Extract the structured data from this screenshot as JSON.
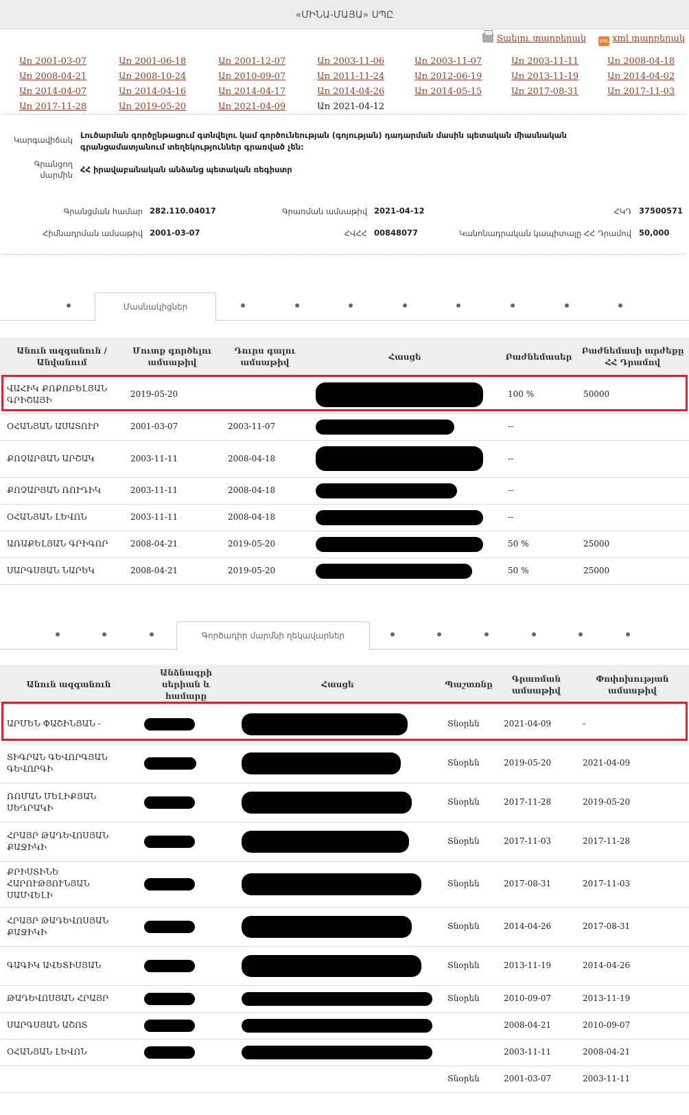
{
  "page": {
    "title": "«ՄԻՆԱ-ՄԱՅԱ» ՍՊԸ",
    "print_label": "Տպելու տարբերակ",
    "xml_label": "xml տարբերակ",
    "icons": {
      "print": "printer-icon",
      "xml": "xml-file-icon"
    },
    "accent_color": "#b03a1a",
    "highlight_color": "#e0202a"
  },
  "dates": [
    {
      "label": "Առ 2001-03-07",
      "current": false
    },
    {
      "label": "Առ 2001-06-18",
      "current": false
    },
    {
      "label": "Առ 2001-12-07",
      "current": false
    },
    {
      "label": "Առ 2003-11-06",
      "current": false
    },
    {
      "label": "Առ 2003-11-07",
      "current": false
    },
    {
      "label": "Առ 2003-11-11",
      "current": false
    },
    {
      "label": "Առ 2008-04-18",
      "current": false
    },
    {
      "label": "Առ 2008-04-21",
      "current": false
    },
    {
      "label": "Առ 2008-10-24",
      "current": false
    },
    {
      "label": "Առ 2010-09-07",
      "current": false
    },
    {
      "label": "Առ 2011-11-24",
      "current": false
    },
    {
      "label": "Առ 2012-06-19",
      "current": false
    },
    {
      "label": "Առ 2013-11-19",
      "current": false
    },
    {
      "label": "Առ 2014-04-02",
      "current": false
    },
    {
      "label": "Առ 2014-04-07",
      "current": false
    },
    {
      "label": "Առ 2014-04-16",
      "current": false
    },
    {
      "label": "Առ 2014-04-17",
      "current": false
    },
    {
      "label": "Առ 2014-04-26",
      "current": false
    },
    {
      "label": "Առ 2014-05-15",
      "current": false
    },
    {
      "label": "Առ 2017-08-31",
      "current": false
    },
    {
      "label": "Առ 2017-11-03",
      "current": false
    },
    {
      "label": "Առ 2017-11-28",
      "current": false
    },
    {
      "label": "Առ 2019-05-20",
      "current": false
    },
    {
      "label": "Առ 2021-04-09",
      "current": false
    },
    {
      "label": "Առ 2021-04-12",
      "current": true
    }
  ],
  "info": {
    "status_label": "Կարգավիճակ",
    "status_value": "Լուծարման գործընթացում գտնվելու կամ գործունեության (գոյության) դադարման մասին պետական միասնական գրանցամատյանում տեղեկություններ գրառված չեն:",
    "registrar_label": "Գրանցող մարմին",
    "registrar_value": "ՀՀ իրավաբանական անձանց պետական ռեգիստր",
    "reg_no_label": "Գրանցման համար",
    "reg_no_value": "282.110.04017",
    "reg_date_label": "Գրառման ամսաթիվ",
    "reg_date_value": "2021-04-12",
    "tin_label": "ՀԿԴ",
    "tin_value": "37500571",
    "found_date_label": "Հիմնադրման ամսաթիվ",
    "found_date_value": "2001-03-07",
    "hvhh_label": "ՀՎՀՀ",
    "hvhh_value": "00848077",
    "capital_label": "Կանոնադրական կապիտալը ՀՀ Դրամով",
    "capital_value": "50,000"
  },
  "members": {
    "tab_label": "Մասնակիցներ",
    "headers": [
      "Անուն ազգանուն / Անվանում",
      "Մուտք գործելու ամսաթիվ",
      "Դուրս գալու ամսաթիվ",
      "Հասցե",
      "Բաժնեմասեր",
      "Բաժնեմասի արժեքը ՀՀ Դրամով"
    ],
    "rows": [
      {
        "name": "ՎԱՀԻԿ ՔՈՔՈԲԵԼՅԱՆ ԳՐԻՇԱՅԻ",
        "in": "2019-05-20",
        "out": "",
        "share": "100 %",
        "value": "50000"
      },
      {
        "name": "ՕՀԱՆՅԱՆ ԱՍԱՏՈՒՐ",
        "in": "2001-03-07",
        "out": "2003-11-07",
        "share": "--",
        "value": ""
      },
      {
        "name": "ՔՈՉԱՐՅԱՆ ԱՐՇԱԿ",
        "in": "2003-11-11",
        "out": "2008-04-18",
        "share": "--",
        "value": ""
      },
      {
        "name": "ՔՈՉԱՐՅԱՆ ՌՈՒԴԻԿ",
        "in": "2003-11-11",
        "out": "2008-04-18",
        "share": "--",
        "value": ""
      },
      {
        "name": "ՕՀԱՆՅԱՆ ԼԵՎՈՆ",
        "in": "2003-11-11",
        "out": "2008-04-18",
        "share": "--",
        "value": ""
      },
      {
        "name": "ԱՌԱՔԵԼՅԱՆ ԳՐԻԳՈՐ",
        "in": "2008-04-21",
        "out": "2019-05-20",
        "share": "50 %",
        "value": "25000"
      },
      {
        "name": "ՍԱՐԳՍՅԱՆ ՆԱՐԵԿ",
        "in": "2008-04-21",
        "out": "2019-05-20",
        "share": "50 %",
        "value": "25000"
      }
    ]
  },
  "managers": {
    "tab_label": "Գործադիր մարմնի ղեկավարներ",
    "headers": [
      "Անուն ազգանուն",
      "Անձնագրի սերիան և համարը",
      "Հասցե",
      "Պաշտոնը",
      "Գրառման ամսաթիվ",
      "Փոփոխության ամսաթիվ"
    ],
    "rows": [
      {
        "name": "ԱՐՄԵՆ ՓԱՇԻՆՅԱՆ -",
        "position": "Տնօրեն",
        "rec": "2021-04-09",
        "chg": "-"
      },
      {
        "name": "ՏԻԳՐԱՆ ԳԵՎՈՐԳՅԱՆ ԳԵՎՈՐԳԻ",
        "position": "Տնօրեն",
        "rec": "2019-05-20",
        "chg": "2021-04-09"
      },
      {
        "name": "ՌՈՄԱՆ ՄԵԼԻՔՅԱՆ ՍԵԴՐԱԿԻ",
        "position": "Տնօրեն",
        "rec": "2017-11-28",
        "chg": "2019-05-20"
      },
      {
        "name": "ՀՐԱՅՐ ԹԱԴԵՎՈՍՅԱՆ ՔԱՋԻԿԻ",
        "position": "Տնօրեն",
        "rec": "2017-11-03",
        "chg": "2017-11-28"
      },
      {
        "name": "ՔՐԻՍՏԻՆԵ ՀԱՐՈՒԹՅՈՒՆՅԱՆ ՍԱՄՎԵԼԻ",
        "position": "Տնօրեն",
        "rec": "2017-08-31",
        "chg": "2017-11-03"
      },
      {
        "name": "ՀՐԱՅՐ ԹԱԴԵՎՈՍՅԱՆ ՔԱՋԻԿԻ",
        "position": "Տնօրեն",
        "rec": "2014-04-26",
        "chg": "2017-08-31"
      },
      {
        "name": "ԳԱԳԻԿ ԱՎԵՏԻՍՅԱՆ",
        "position": "Տնօրեն",
        "rec": "2013-11-19",
        "chg": "2014-04-26"
      },
      {
        "name": "ԹԱԴԵՎՈՍՅԱՆ ՀՐԱՅՐ",
        "position": "Տնօրեն",
        "rec": "2010-09-07",
        "chg": "2013-11-19"
      },
      {
        "name": "ՍԱՐԳՍՅԱՆ ԱՇՈՏ",
        "position": "",
        "rec": "2008-04-21",
        "chg": "2010-09-07"
      },
      {
        "name": "ՕՀԱՆՅԱՆ ԼԵՎՈՆ",
        "position": "",
        "rec": "2003-11-11",
        "chg": "2008-04-21"
      },
      {
        "name": "",
        "position": "Տնօրեն",
        "rec": "2001-03-07",
        "chg": "2003-11-11"
      }
    ]
  }
}
